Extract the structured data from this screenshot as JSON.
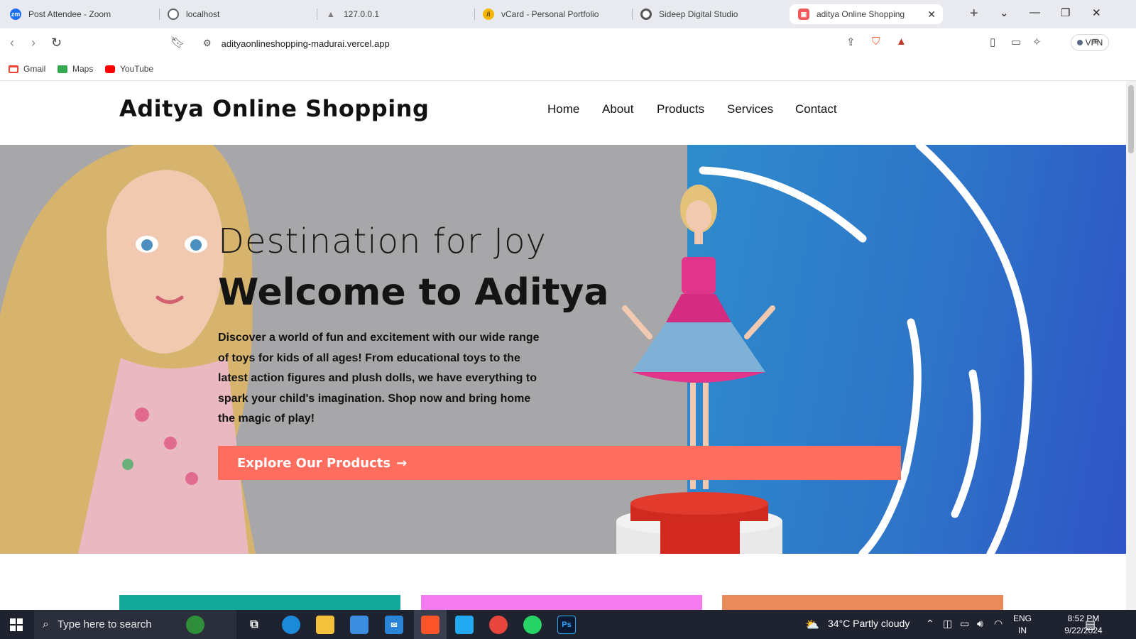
{
  "browser": {
    "tabs": [
      {
        "title": "Post Attendee - Zoom",
        "icon": "zoom-icon",
        "fav_text": "zm",
        "color": "#1b6ff5"
      },
      {
        "title": "localhost",
        "icon": "globe-icon",
        "fav_text": "",
        "color": "#5f6368"
      },
      {
        "title": "127.0.0.1",
        "icon": "mountain-icon",
        "fav_text": "",
        "color": "#7b7b7b"
      },
      {
        "title": "vCard - Personal Portfolio",
        "icon": "vcard-icon",
        "fav_text": "/i",
        "color": "#f2b705"
      },
      {
        "title": "Sideep Digital Studio",
        "icon": "studio-icon",
        "fav_text": "",
        "color": "#555555"
      },
      {
        "title": "aditya Online Shopping",
        "icon": "shopping-bag-icon",
        "fav_text": "",
        "color": "#f05a5a"
      }
    ],
    "active_tab": 5,
    "url": "adityaonlineshopping-madurai.vercel.app",
    "vpn_label": "VPN",
    "bookmarks": [
      {
        "label": "Gmail",
        "color": "#ea4335"
      },
      {
        "label": "Maps",
        "color": "#34a853"
      },
      {
        "label": "YouTube",
        "color": "#ff0000"
      }
    ]
  },
  "site": {
    "brand": "Aditya Online Shopping",
    "menu": [
      "Home",
      "About",
      "Products",
      "Services",
      "Contact"
    ],
    "hero": {
      "tagline": "Destination for Joy",
      "headline": "Welcome to Aditya",
      "description": "Discover a world of fun and excitement with our wide range of toys for kids of all ages! From educational toys to the latest action figures and plush dolls, we have everything to spark your child's imagination. Shop now and bring home the magic of play!",
      "cta_label": "Explore Our Products",
      "cta_arrow": "→"
    },
    "card_colors": [
      "#14a89a",
      "#f47cf0",
      "#e88a5a"
    ]
  },
  "taskbar": {
    "search_placeholder": "Type here to search",
    "weather": "34°C  Partly cloudy",
    "lang_top": "ENG",
    "lang_bottom": "IN",
    "time": "8:52 PM",
    "date": "9/22/2024"
  }
}
